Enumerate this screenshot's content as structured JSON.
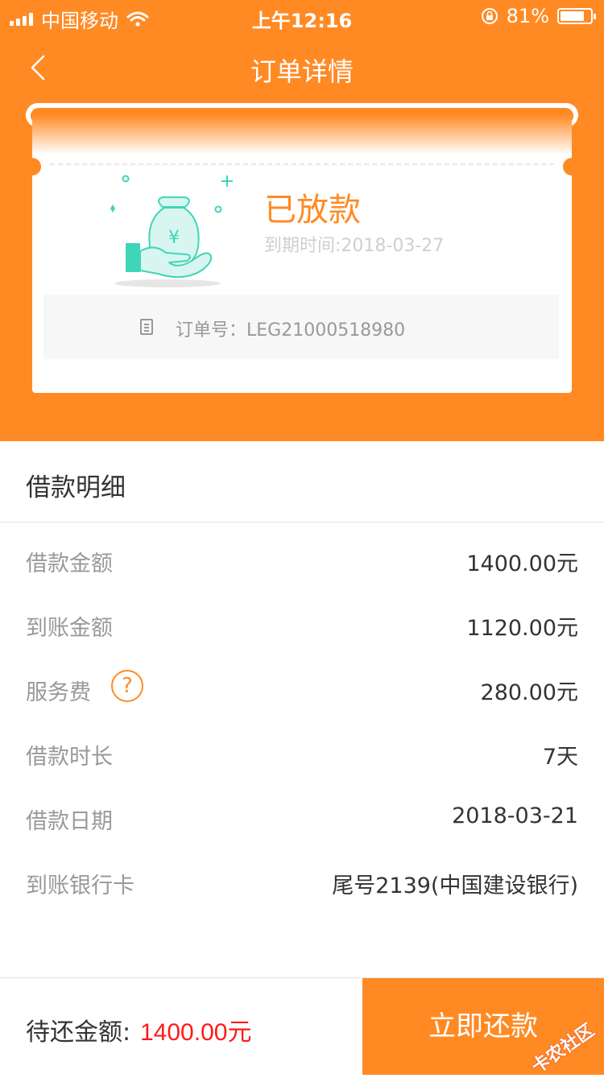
{
  "status_bar": {
    "carrier": "中国移动",
    "time": "上午12:16",
    "battery": "81%",
    "battery_level": 0.81
  },
  "nav": {
    "title": "订单详情"
  },
  "card": {
    "status": "已放款",
    "due_date": "到期时间:2018-03-27",
    "order_number": "订单号：LEG21000518980"
  },
  "details": {
    "title": "借款明细",
    "rows": [
      {
        "label": "借款金额",
        "value": "1400.00元"
      },
      {
        "label": "到账金额",
        "value": "1120.00元"
      },
      {
        "label": "服务费",
        "value": "280.00元"
      },
      {
        "label": "借款时长",
        "value": "7天"
      },
      {
        "label": "借款日期",
        "value": "2018-03-21"
      },
      {
        "label": "到账银行卡",
        "value": "尾号2139(中国建设银行)"
      }
    ]
  },
  "bottom": {
    "due_label": "待还金额:",
    "due_amount": "1400.00元",
    "repay_button": "立即还款",
    "watermark": "卡农社区"
  },
  "colors": {
    "accent": "#FF8A24",
    "amount_red": "#FF1A1A",
    "teal": "#3ED6B8"
  }
}
